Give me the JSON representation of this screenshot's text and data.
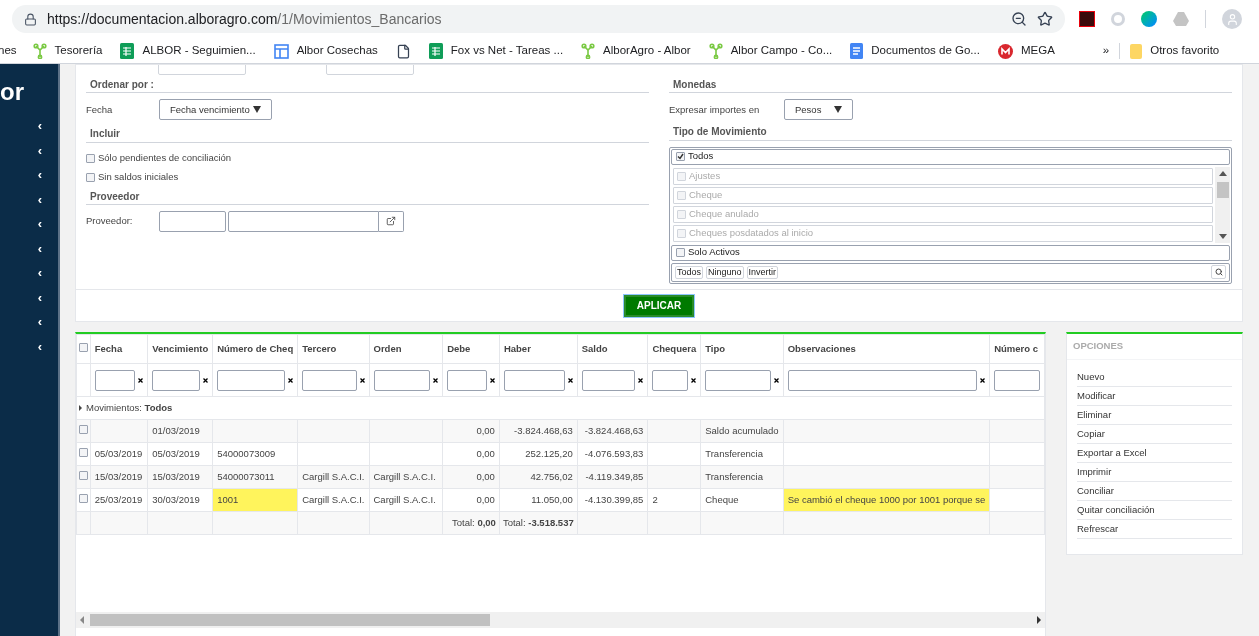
{
  "browser": {
    "url_host": "https://documentacion.alboragro.com",
    "url_path": "/1/Movimientos_Bancarios",
    "bookmarks": [
      {
        "label": "nes",
        "kind": "none"
      },
      {
        "label": "Tesorería",
        "kind": "branch"
      },
      {
        "label": "ALBOR - Seguimien...",
        "kind": "sheet"
      },
      {
        "label": "Albor Cosechas",
        "kind": "layout"
      },
      {
        "kind": "file"
      },
      {
        "label": "Fox vs Net - Tareas ...",
        "kind": "sheet"
      },
      {
        "label": "AlborAgro - Albor",
        "kind": "branch"
      },
      {
        "label": "Albor Campo - Co...",
        "kind": "branch"
      },
      {
        "label": "Documentos de Go...",
        "kind": "doc"
      },
      {
        "label": "MEGA",
        "kind": "mega"
      }
    ],
    "more": "»",
    "other_bookmarks": "Otros favorito"
  },
  "sidebar": {
    "logo": "or",
    "items": [
      {
        "icon": "‹"
      },
      {
        "icon": "‹"
      },
      {
        "icon": "‹"
      },
      {
        "icon": "‹"
      },
      {
        "icon": "‹"
      },
      {
        "icon": "‹"
      },
      {
        "icon": "‹"
      },
      {
        "icon": "‹"
      },
      {
        "icon": "‹"
      },
      {
        "icon": "‹"
      }
    ]
  },
  "filters": {
    "order": {
      "title": "Ordenar por :",
      "label": "Fecha",
      "value": "Fecha vencimiento"
    },
    "include": {
      "title": "Incluir",
      "options": [
        {
          "label": "Sólo pendientes de conciliación",
          "checked": false
        },
        {
          "label": "Sin saldos iniciales",
          "checked": false
        }
      ]
    },
    "provider": {
      "title": "Proveedor",
      "label": "Proveedor:"
    },
    "currency": {
      "title": "Monedas",
      "label": "Expresar importes en",
      "value": "Pesos"
    },
    "movement_type": {
      "title": "Tipo de Movimiento",
      "all": {
        "label": "Todos",
        "checked": true
      },
      "items": [
        {
          "label": "Ajustes",
          "checked": false,
          "disabled": true
        },
        {
          "label": "Cheque",
          "checked": false,
          "disabled": true
        },
        {
          "label": "Cheque anulado",
          "checked": false,
          "disabled": true
        },
        {
          "label": "Cheques posdatados al inicio",
          "checked": false,
          "disabled": true
        }
      ],
      "active_only": {
        "label": "Solo Activos",
        "checked": false
      },
      "actions": [
        "Todos",
        "Ninguno",
        "Invertir"
      ]
    },
    "apply": "APLICAR"
  },
  "table": {
    "columns": [
      "Fecha",
      "Vencimiento",
      "Número de Cheq",
      "Tercero",
      "Orden",
      "Debe",
      "Haber",
      "Saldo",
      "Chequera",
      "Tipo",
      "Observaciones",
      "Número c"
    ],
    "group": {
      "label": "Movimientos:",
      "value": "Todos"
    },
    "rows": [
      {
        "checked": false,
        "cells": [
          {},
          {
            "text": "01/03/2019"
          },
          {},
          {},
          {},
          {
            "text": "0,00"
          },
          {
            "text": "-3.824.468,63"
          },
          {
            "text": "-3.824.468,63"
          },
          {},
          {
            "text": "Saldo acumulado"
          },
          {},
          {}
        ]
      },
      {
        "checked": false,
        "cells": [
          {
            "text": "05/03/2019"
          },
          {
            "text": "05/03/2019"
          },
          {
            "text": "54000073009"
          },
          {},
          {},
          {
            "text": "0,00"
          },
          {
            "text": "252.125,20"
          },
          {
            "text": "-4.076.593,83"
          },
          {},
          {
            "text": "Transferencia"
          },
          {},
          {}
        ]
      },
      {
        "checked": false,
        "cells": [
          {
            "text": "15/03/2019"
          },
          {
            "text": "15/03/2019"
          },
          {
            "text": "54000073011"
          },
          {
            "text": "Cargill S.A.C.I."
          },
          {
            "text": "Cargill S.A.C.I."
          },
          {
            "text": "0,00"
          },
          {
            "text": "42.756,02"
          },
          {
            "text": "-4.119.349,85"
          },
          {},
          {
            "text": "Transferencia"
          },
          {},
          {}
        ]
      },
      {
        "checked": false,
        "cells": [
          {
            "text": "25/03/2019"
          },
          {
            "text": "30/03/2019"
          },
          {
            "text": "1001",
            "highlighted": true
          },
          {
            "text": "Cargill S.A.C.I."
          },
          {
            "text": "Cargill S.A.C.I."
          },
          {
            "text": "0,00"
          },
          {
            "text": "11.050,00"
          },
          {
            "text": "-4.130.399,85"
          },
          {
            "text": "2"
          },
          {
            "text": "Cheque"
          },
          {
            "text": "Se cambió el cheque 1000 por 1001 porque se",
            "highlighted": true
          },
          {}
        ]
      }
    ],
    "select_all": {
      "checked": false
    },
    "totals": {
      "debe": "Total: **0,00**",
      "haber": "Total: **-3.518.537**"
    }
  },
  "options": {
    "title": "OPCIONES",
    "items": [
      "Nuevo",
      "Modificar",
      "Eliminar",
      "Copiar",
      "Exportar a Excel",
      "Imprimir",
      "Conciliar",
      "Quitar conciliación",
      "Refrescar"
    ]
  }
}
